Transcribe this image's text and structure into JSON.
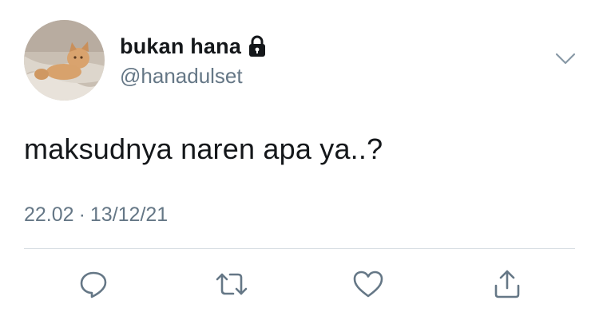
{
  "user": {
    "display_name": "bukan hana",
    "handle": "@hanadulset",
    "avatar_icon": "cat-avatar",
    "protected_icon": "lock-icon"
  },
  "tweet": {
    "text": "maksudnya naren apa ya..?",
    "time": "22.02",
    "separator": "·",
    "date": "13/12/21"
  },
  "actions": {
    "reply_icon": "reply-icon",
    "retweet_icon": "retweet-icon",
    "like_icon": "heart-icon",
    "share_icon": "share-icon"
  },
  "colors": {
    "text": "#14171a",
    "secondary": "#657786",
    "divider": "#d8dee3",
    "icon": "#657786"
  }
}
